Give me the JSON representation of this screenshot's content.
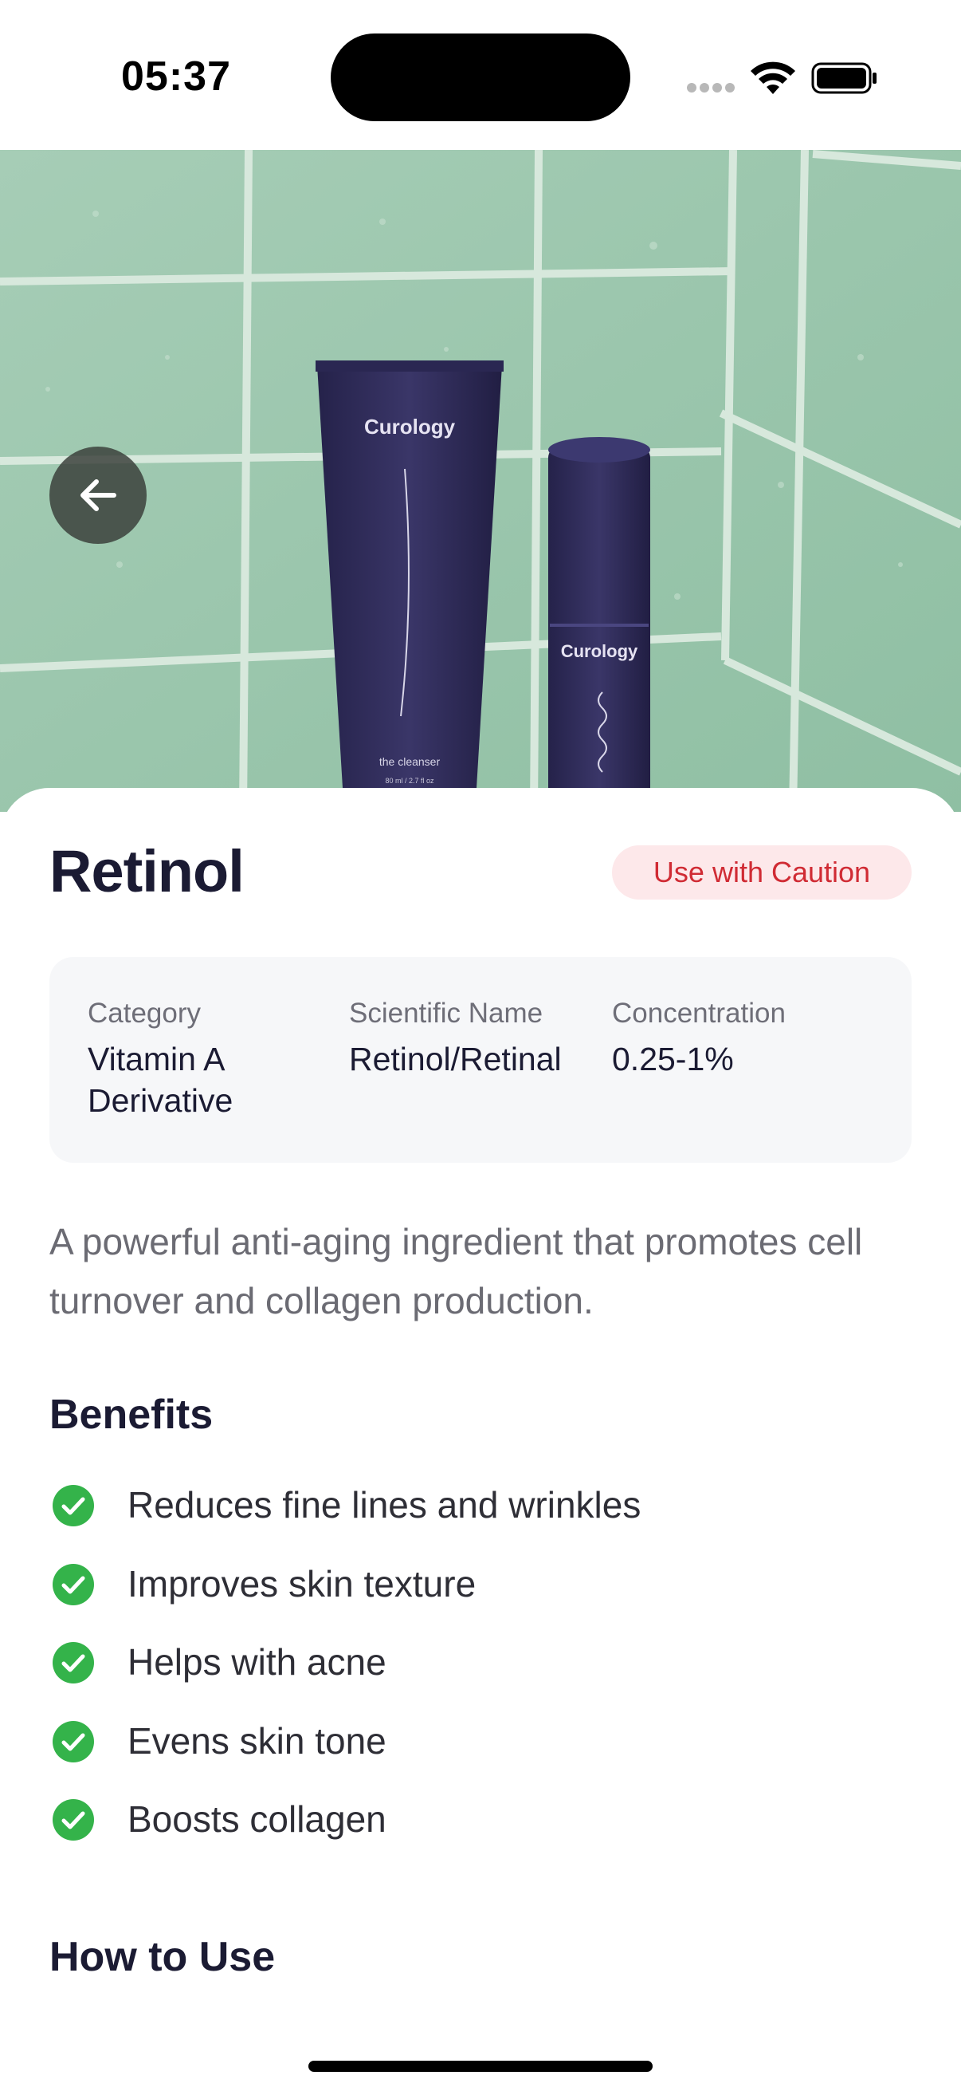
{
  "status_bar": {
    "time": "05:37"
  },
  "hero": {
    "product_brand_tube": "Curology",
    "product_brand_bottle": "Curology",
    "product_tube_label": "the cleanser",
    "product_tube_size": "80 ml / 2.7 fl oz"
  },
  "ingredient": {
    "name": "Retinol",
    "safety_badge": "Use with Caution",
    "info": [
      {
        "label": "Category",
        "value": "Vitamin A Derivative"
      },
      {
        "label": "Scientific Name",
        "value": "Retinol/Retinal"
      },
      {
        "label": "Concentration",
        "value": "0.25-1%"
      }
    ],
    "description": "A powerful anti-aging ingredient that promotes cell turnover and collagen production."
  },
  "benefits": {
    "title": "Benefits",
    "items": [
      "Reduces fine lines and wrinkles",
      "Improves skin texture",
      "Helps with acne",
      "Evens skin tone",
      "Boosts collagen"
    ]
  },
  "how_to_use": {
    "title": "How to Use"
  },
  "colors": {
    "badge_text": "#d02b34",
    "badge_bg": "#fde8ea",
    "check_green": "#34b34a",
    "title_text": "#1b1b33",
    "tile_green": "#9cc7ad"
  },
  "icons": {
    "back": "arrow-left-icon",
    "benefit": "check-circle-icon",
    "wifi": "wifi-icon",
    "battery": "battery-icon",
    "signal": "signal-icon"
  }
}
